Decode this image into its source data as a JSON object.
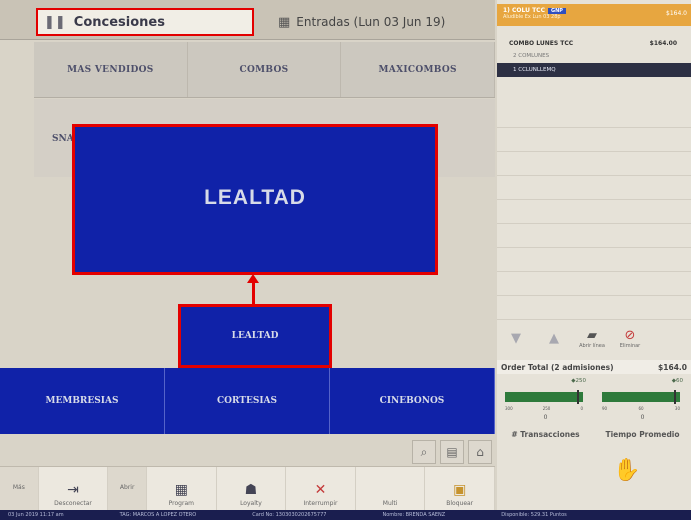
{
  "tabs": {
    "concesiones": "Concesiones",
    "entradas": "Entradas (Lun 03 Jun 19)"
  },
  "categories": [
    "MAS VENDIDOS",
    "COMBOS",
    "MAXICOMBOS"
  ],
  "category_row2": "SNA",
  "zoom_label": "LEALTAD",
  "lealtad_button": "LEALTAD",
  "blue_row": [
    "MEMBRESIAS",
    "CORTESIAS",
    "CINEBONOS"
  ],
  "toolbar": {
    "more_left": "Más",
    "disconnect": "Desconectar",
    "abrir": "Abrir",
    "program": "Program",
    "loyalty": "Loyalty",
    "interrumpir": "Interrumpir",
    "multi": "Multi",
    "bloquear": "Bloquear"
  },
  "status": {
    "date": "03 Jun 2019 11:17 am",
    "tag": "TAG: MARCOS A LOPEZ OTERO",
    "card": "Card No: 1303030202675777",
    "nombre": "Nombre: BRENDA SAENZ",
    "disponible": "Disponible: 529.31 Puntos"
  },
  "order": {
    "title": "1) COLU TCC",
    "badge": "GNP",
    "subtitle": "Aludible Ex Lun 03 28p",
    "price": "$164.0",
    "item_title": "COMBO LUNES TCC",
    "item_price": "$164.00",
    "items": [
      "2   COMLUNES",
      "1   CCLUNLLEMQ"
    ],
    "abrir_linea": "Abrir línea",
    "eliminar": "Eliminar",
    "total_label": "Order Total (2 admisiones)",
    "total_value": "$164.0"
  },
  "gauges": [
    {
      "top": "◆250",
      "ticks": [
        "300",
        "250",
        "0"
      ],
      "value": "0",
      "label": "# Transacciones"
    },
    {
      "top": "◆60",
      "ticks": [
        "90",
        "60",
        "30"
      ],
      "value": "0",
      "label": "Tiempo Promedio"
    }
  ]
}
